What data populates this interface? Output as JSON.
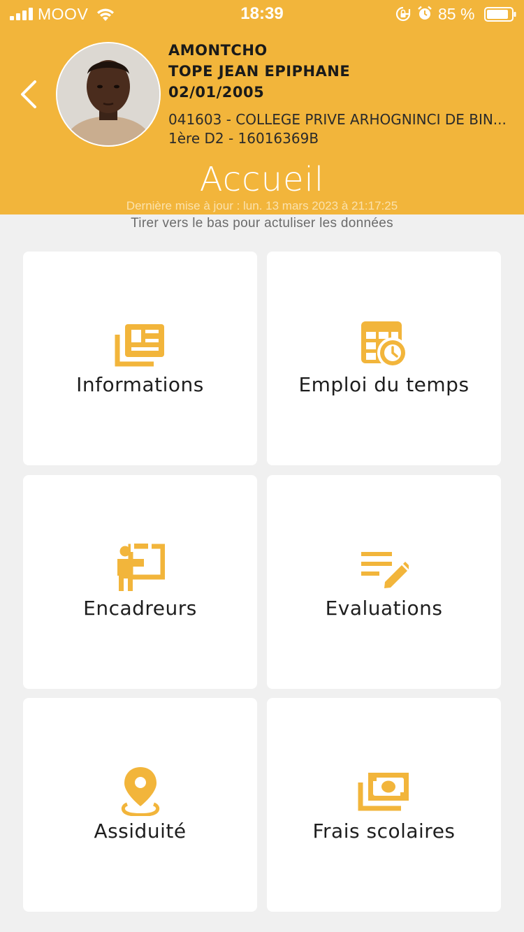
{
  "colors": {
    "accent": "#f2b53b",
    "icon": "#f2b53b",
    "background": "#f0f0f0",
    "tile": "#ffffff"
  },
  "status_bar": {
    "carrier": "MOOV",
    "time": "18:39",
    "battery_percent": "85 %"
  },
  "student": {
    "last_name": "AMONTCHO",
    "first_names": "TOPE JEAN EPIPHANE",
    "birth_date": "02/01/2005",
    "school": "041603 - COLLEGE PRIVE ARHOGNINCI DE BIN...",
    "class_and_id": "1ère D2 - 16016369B"
  },
  "page": {
    "title": "Accueil",
    "last_update": "Dernière mise à jour : lun. 13 mars 2023 à 21:17:25",
    "pull_hint": "Tirer vers le bas pour actuliser les données"
  },
  "tiles": [
    {
      "label": "Informations",
      "icon": "newspaper-icon"
    },
    {
      "label": "Emploi du temps",
      "icon": "schedule-icon"
    },
    {
      "label": "Encadreurs",
      "icon": "teacher-icon"
    },
    {
      "label": "Evaluations",
      "icon": "edit-list-icon"
    },
    {
      "label": "Assiduité",
      "icon": "location-pin-icon"
    },
    {
      "label": "Frais scolaires",
      "icon": "money-icon"
    }
  ]
}
